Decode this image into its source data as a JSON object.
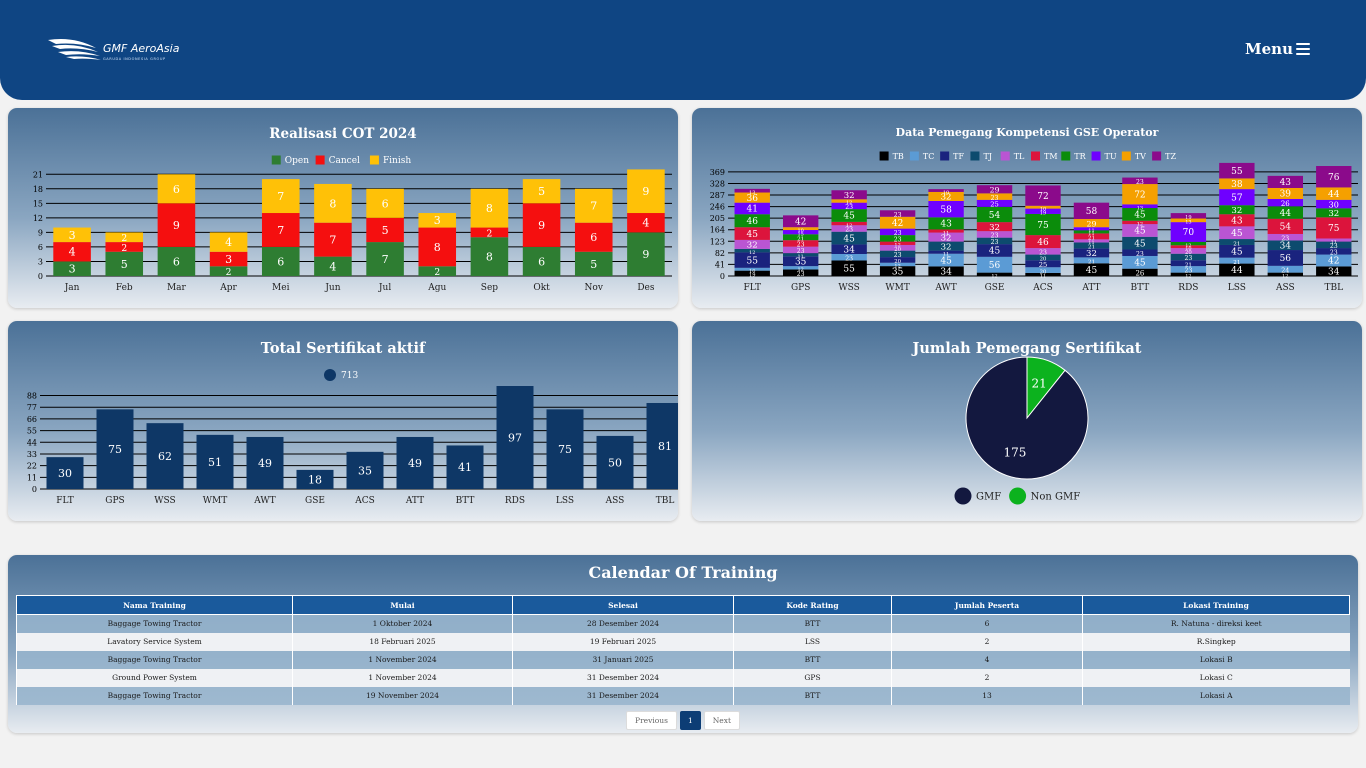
{
  "header": {
    "brand": "GMF AeroAsia",
    "brand_sub": "GARUDA INDONESIA GROUP",
    "menu_label": "Menu"
  },
  "cot": {
    "chart_data": {
      "type": "bar",
      "stacked": true,
      "title": "Realisasi COT 2024",
      "categories": [
        "Jan",
        "Feb",
        "Mar",
        "Apr",
        "Mei",
        "Jun",
        "Jul",
        "Agu",
        "Sep",
        "Okt",
        "Nov",
        "Des"
      ],
      "series": [
        {
          "name": "Open",
          "color": "#2e7d32",
          "values": [
            3,
            5,
            6,
            2,
            6,
            4,
            7,
            2,
            8,
            6,
            5,
            9
          ]
        },
        {
          "name": "Cancel",
          "color": "#f50f0f",
          "values": [
            4,
            2,
            9,
            3,
            7,
            7,
            5,
            8,
            2,
            9,
            6,
            4
          ]
        },
        {
          "name": "Finish",
          "color": "#ffc107",
          "values": [
            3,
            2,
            6,
            4,
            7,
            8,
            6,
            3,
            8,
            5,
            7,
            9
          ]
        }
      ],
      "y_ticks": [
        0,
        3,
        6,
        9,
        12,
        15,
        18,
        21
      ],
      "ylim": [
        0,
        22.5
      ],
      "legend": "top-center",
      "grid": true
    }
  },
  "gse": {
    "chart_data": {
      "type": "bar",
      "stacked": true,
      "title": "Data Pemegang Kompetensi GSE Operator",
      "categories": [
        "FLT",
        "GPS",
        "WSS",
        "WMT",
        "AWT",
        "GSE",
        "ACS",
        "ATT",
        "BTT",
        "RDS",
        "LSS",
        "ASS",
        "TBL"
      ],
      "series": [
        {
          "name": "TB",
          "color": "#000000",
          "values": [
            19,
            23,
            55,
            35,
            34,
            12,
            11,
            45,
            26,
            12,
            44,
            12,
            34
          ]
        },
        {
          "name": "TC",
          "color": "#5b9bd5",
          "values": [
            10,
            12,
            23,
            12,
            45,
            56,
            20,
            21,
            45,
            23,
            21,
            24,
            42
          ]
        },
        {
          "name": "TF",
          "color": "#1a237e",
          "values": [
            55,
            35,
            34,
            20,
            11,
            45,
            25,
            32,
            23,
            21,
            45,
            56,
            23
          ]
        },
        {
          "name": "TJ",
          "color": "#0d4b6e",
          "values": [
            12,
            11,
            45,
            23,
            32,
            23,
            20,
            21,
            45,
            23,
            21,
            34,
            23
          ]
        },
        {
          "name": "TL",
          "color": "#ba55d3",
          "values": [
            32,
            23,
            23,
            20,
            32,
            23,
            23,
            11,
            45,
            20,
            45,
            23,
            11
          ]
        },
        {
          "name": "TM",
          "color": "#dc143c",
          "values": [
            45,
            23,
            12,
            12,
            11,
            32,
            46,
            21,
            12,
            10,
            43,
            54,
            75
          ]
        },
        {
          "name": "TR",
          "color": "#0b8c0b",
          "values": [
            46,
            21,
            45,
            23,
            43,
            54,
            75,
            11,
            45,
            12,
            32,
            44,
            32
          ]
        },
        {
          "name": "TU",
          "color": "#6f00ff",
          "values": [
            41,
            15,
            23,
            23,
            58,
            25,
            19,
            11,
            13,
            70,
            57,
            26,
            30
          ]
        },
        {
          "name": "TV",
          "color": "#f5a000",
          "values": [
            36,
            10,
            12,
            42,
            32,
            23,
            10,
            29,
            72,
            13,
            38,
            39,
            44
          ]
        },
        {
          "name": "TZ",
          "color": "#8b0a8b",
          "values": [
            13,
            42,
            32,
            23,
            10,
            29,
            72,
            58,
            23,
            19,
            55,
            43,
            76
          ]
        }
      ],
      "y_ticks": [
        0,
        41,
        82,
        123,
        164,
        205,
        246,
        287,
        328,
        369
      ],
      "ylim": [
        0,
        390
      ],
      "legend": "top-center",
      "grid": true
    }
  },
  "sertifikat": {
    "chart_data": {
      "type": "bar",
      "title": "Total Sertifikat aktif",
      "categories": [
        "FLT",
        "GPS",
        "WSS",
        "WMT",
        "AWT",
        "GSE",
        "ACS",
        "ATT",
        "BTT",
        "RDS",
        "LSS",
        "ASS",
        "TBL"
      ],
      "series": [
        {
          "name": "713",
          "color": "#0e3766",
          "values": [
            30,
            75,
            62,
            51,
            49,
            18,
            35,
            49,
            41,
            97,
            75,
            50,
            81
          ]
        }
      ],
      "y_ticks": [
        0,
        11,
        22,
        33,
        44,
        55,
        66,
        77,
        88
      ],
      "ylim": [
        0,
        97
      ],
      "legend": "top-center",
      "grid": true
    }
  },
  "pemegang": {
    "chart_data": {
      "type": "pie",
      "title": "Jumlah Pemegang Sertifikat",
      "slices": [
        {
          "name": "GMF",
          "value": 175,
          "color": "#13183f"
        },
        {
          "name": "Non GMF",
          "value": 21,
          "color": "#0cb21e"
        }
      ],
      "legend": "bottom"
    }
  },
  "calendar": {
    "title": "Calendar Of Training",
    "columns": [
      "Nama Training",
      "Mulai",
      "Selesai",
      "Kode Rating",
      "Jumlah Peserta",
      "Lokasi Training"
    ],
    "rows": [
      [
        "Baggage Towing Tractor",
        "1 Oktober 2024",
        "28 Desember 2024",
        "BTT",
        "6",
        "R. Natuna - direksi keet"
      ],
      [
        "Lavatory Service System",
        "18 Februari 2025",
        "19 Februari 2025",
        "LSS",
        "2",
        "R.Singkep"
      ],
      [
        "Baggage Towing Tractor",
        "1 November 2024",
        "31 Januari 2025",
        "BTT",
        "4",
        "Lokasi B"
      ],
      [
        "Ground Power System",
        "1 November 2024",
        "31 Desember 2024",
        "GPS",
        "2",
        "Lokasi C"
      ],
      [
        "Baggage Towing Tractor",
        "19 November 2024",
        "31 Desember 2024",
        "BTT",
        "13",
        "Lokasi A"
      ]
    ],
    "pager": {
      "previous": "Previous",
      "page": "1",
      "next": "Next"
    }
  }
}
